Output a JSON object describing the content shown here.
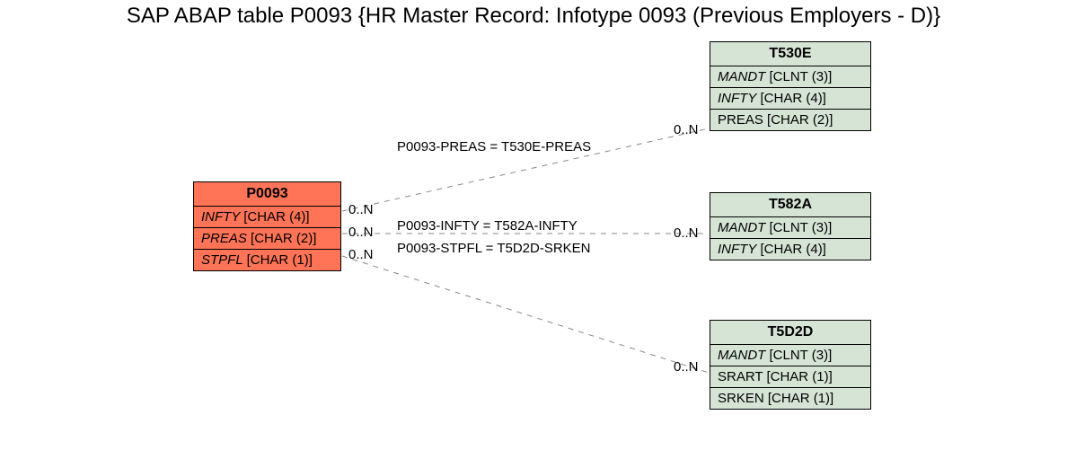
{
  "title": "SAP ABAP table P0093 {HR Master Record: Infotype 0093 (Previous Employers - D)}",
  "source": {
    "name": "P0093",
    "fields": [
      {
        "name": "INFTY",
        "type": "[CHAR (4)]"
      },
      {
        "name": "PREAS",
        "type": "[CHAR (2)]"
      },
      {
        "name": "STPFL",
        "type": "[CHAR (1)]"
      }
    ],
    "card_out": [
      "0..N",
      "0..N",
      "0..N"
    ]
  },
  "targets": [
    {
      "name": "T530E",
      "fields": [
        {
          "name": "MANDT",
          "type": "[CLNT (3)]",
          "italic": true
        },
        {
          "name": "INFTY",
          "type": "[CHAR (4)]",
          "italic": true
        },
        {
          "name": "PREAS",
          "type": "[CHAR (2)]",
          "italic": false
        }
      ],
      "card_in": "0..N"
    },
    {
      "name": "T582A",
      "fields": [
        {
          "name": "MANDT",
          "type": "[CLNT (3)]",
          "italic": true
        },
        {
          "name": "INFTY",
          "type": "[CHAR (4)]",
          "italic": true
        }
      ],
      "card_in": "0..N"
    },
    {
      "name": "T5D2D",
      "fields": [
        {
          "name": "MANDT",
          "type": "[CLNT (3)]",
          "italic": true
        },
        {
          "name": "SRART",
          "type": "[CHAR (1)]",
          "italic": false
        },
        {
          "name": "SRKEN",
          "type": "[CHAR (1)]",
          "italic": false
        }
      ],
      "card_in": "0..N"
    }
  ],
  "edges": [
    {
      "label": "P0093-PREAS = T530E-PREAS"
    },
    {
      "label": "P0093-INFTY = T582A-INFTY"
    },
    {
      "label": "P0093-STPFL = T5D2D-SRKEN"
    }
  ]
}
